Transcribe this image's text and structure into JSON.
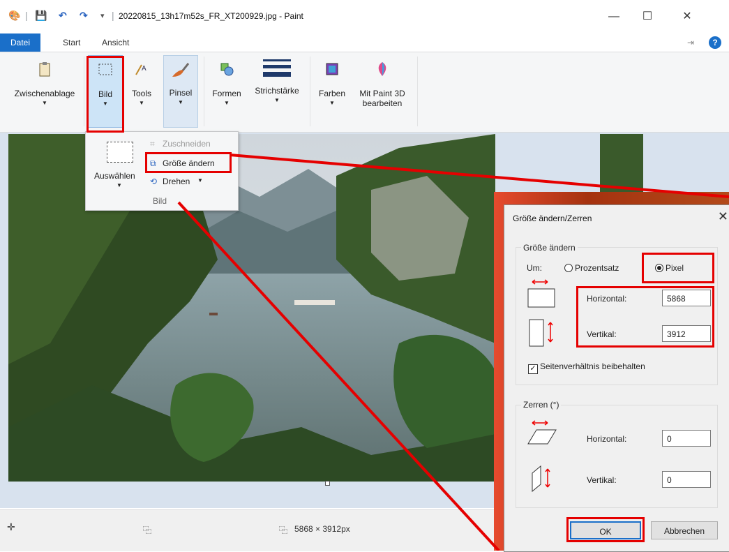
{
  "window": {
    "title": "20220815_13h17m52s_FR_XT200929.jpg - Paint",
    "minimize": "—",
    "maximize": "☐",
    "close": "✕"
  },
  "tabs": [
    "Datei",
    "Start",
    "Ansicht"
  ],
  "ribbon": {
    "groups": [
      {
        "label": "Zwischenablage",
        "icon": "clipboard-icon"
      },
      {
        "label": "Bild",
        "icon": "select-icon"
      },
      {
        "label": "Tools",
        "icon": "tools-icon"
      },
      {
        "label": "Pinsel",
        "icon": "brush-icon"
      },
      {
        "label": "Formen",
        "icon": "shapes-icon"
      },
      {
        "label": "Strichstärke",
        "icon": "stroke-icon"
      },
      {
        "label": "Farben",
        "icon": "colors-icon"
      },
      {
        "label": "Mit Paint 3D bearbeiten",
        "label_line1": "Mit Paint 3D",
        "label_line2": "bearbeiten",
        "icon": "paint3d-icon"
      }
    ]
  },
  "bild_menu": {
    "auswaehlen": "Auswählen",
    "zuschneiden": "Zuschneiden",
    "groesse_aendern": "Größe ändern",
    "drehen": "Drehen",
    "group_label": "Bild"
  },
  "status": {
    "size": "5868 × 3912px"
  },
  "dialog": {
    "title": "Größe ändern/Zerren",
    "resize_group": "Größe ändern",
    "um_label": "Um:",
    "prozentsatz": "Prozentsatz",
    "pixel": "Pixel",
    "horizontal_label": "Horizontal:",
    "horizontal_value": "5868",
    "vertikal_label": "Vertikal:",
    "vertikal_value": "3912",
    "keep_ratio": "Seitenverhältnis beibehalten",
    "skew_group": "Zerren (°)",
    "skew_horizontal_label": "Horizontal:",
    "skew_horizontal_value": "0",
    "skew_vertikal_label": "Vertikal:",
    "skew_vertikal_value": "0",
    "ok": "OK",
    "cancel": "Abbrechen"
  },
  "colors": {
    "accent_blue": "#1a6fc9",
    "highlight_red": "#e50000"
  }
}
